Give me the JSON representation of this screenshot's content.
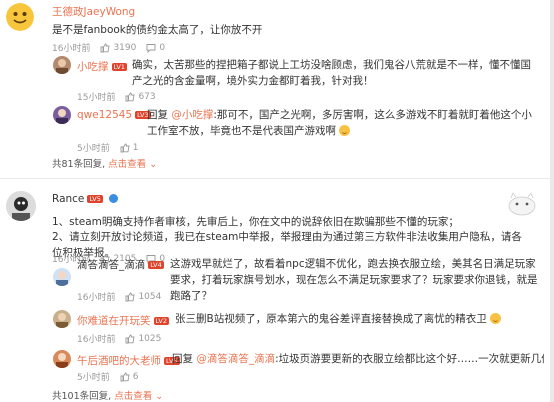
{
  "thread1": {
    "user": "王德政JaeyWong",
    "text": "是不是fanbook的债约金太高了，让你放不开",
    "time": "16小时前",
    "likes": "3190",
    "comments": "0",
    "replies": [
      {
        "user": "小吃撑",
        "badge": "LV1",
        "text": "确实，太苦那些的捏把箱子都说上工坊没啥顾虑，我们鬼谷八荒就是不一样，懂不懂国产之光的含金量啊，境外实力金都盯着我，针对我！",
        "time": "15小时前",
        "likes": "673"
      },
      {
        "user": "qwe12545",
        "badge": "LV3",
        "reply_word": "回复",
        "at": "@小吃撑",
        "text": ":那可不，国产之光啊，多厉害啊，这么多游戏不盯着就盯着他这个小工作室不放，毕竟也不是代表国产游戏啊",
        "time": "5小时前",
        "likes": "1"
      }
    ],
    "more_prefix": "共81条回复,",
    "more_link": "点击查看"
  },
  "thread2": {
    "user": "Rance",
    "badge": "LV5",
    "text1": "1、steam明确支持作者审核，先审后上，你在文中的说辞依旧在欺骗那些不懂的玩家；",
    "text2": "2、请立刻开放讨论频道，我已在steam中举报，举报理由为通过第三方软件非法收集用户隐私，请各位积极举报。",
    "time": "16小时前",
    "likes": "2105",
    "comments": "0",
    "replies": [
      {
        "user": "滴答滴答_滴滴",
        "badge": "LV4",
        "text": "这游戏早就烂了，故看着npc逻辑不优化，跑去换衣服立绘，美其名日满足玩家要求，打着玩家旗号划水，现在怎么不满足玩家要求了？玩家要求你退钱，就是跑路了？",
        "time": "16小时前",
        "likes": "1054"
      },
      {
        "user": "你难道在开玩笑",
        "badge": "LV2",
        "text": "张三删B站视频了，原本第六的鬼谷差评直接替换成了离忧的精衣卫",
        "time": "16小时前",
        "likes": "1025"
      },
      {
        "user": "午后酒吧的大老师",
        "badge": "LV3",
        "reply_word": "回复",
        "at": "@滴答滴答_滴滴",
        "text": ":垃圾页游要更新的衣服立绘都比这个好……一次就更新几件衣服。我的天……",
        "time": "5小时前",
        "likes": "6"
      }
    ],
    "more_prefix": "共101条回复,",
    "more_link": "点击查看"
  }
}
